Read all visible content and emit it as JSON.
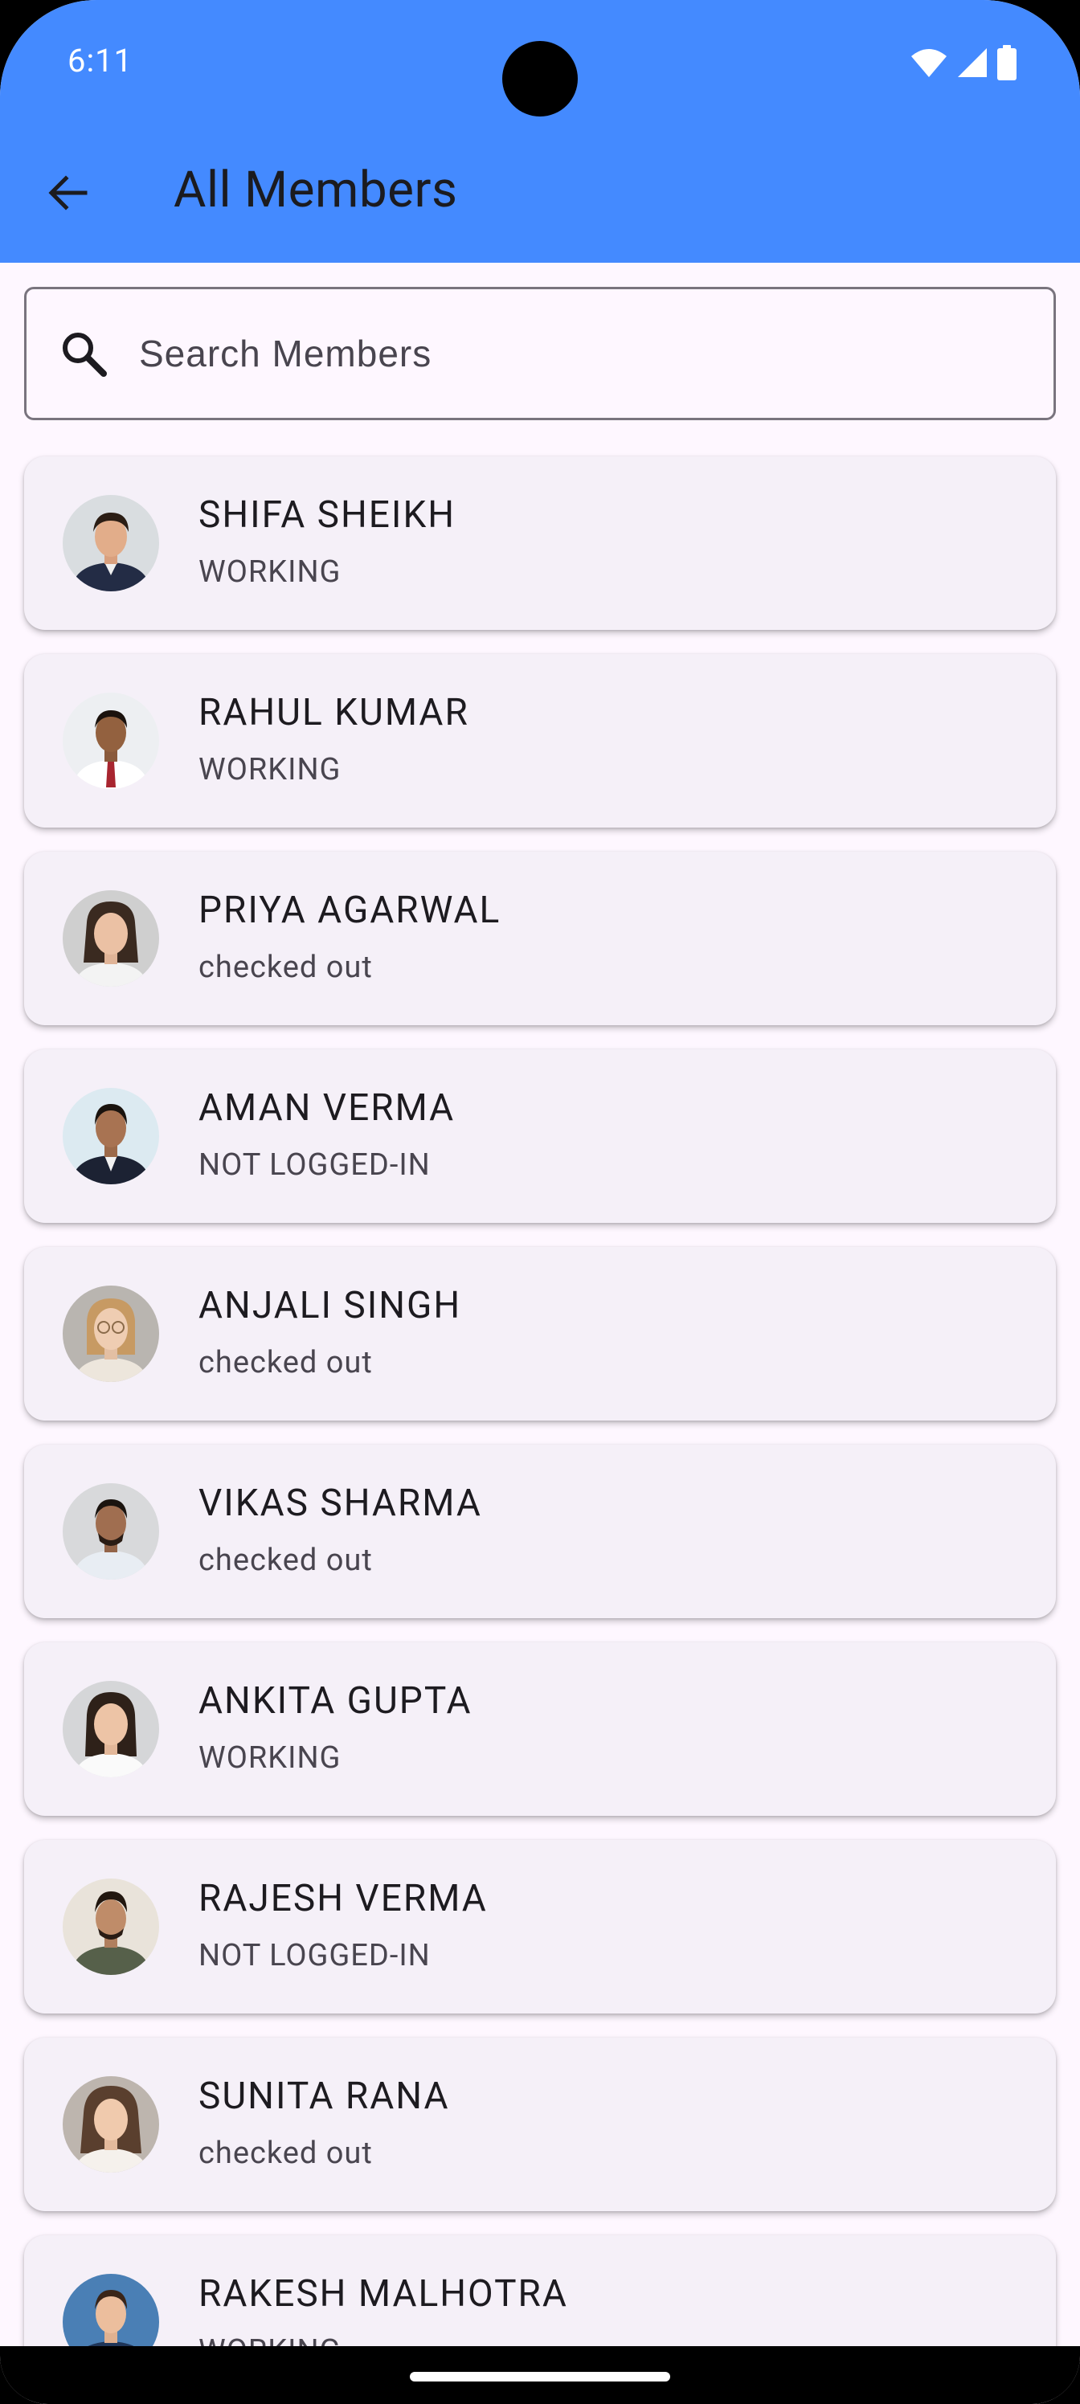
{
  "status_bar": {
    "time": "6:11",
    "icons": [
      "wifi-icon",
      "cellular-signal-icon",
      "battery-icon"
    ]
  },
  "app_bar": {
    "back_icon": "arrow-back-icon",
    "title": "All Members",
    "color": "#448AFF"
  },
  "search": {
    "icon": "search-icon",
    "placeholder": "Search Members",
    "value": ""
  },
  "members": [
    {
      "name": "SHIFA SHEIKH",
      "status": "WORKING",
      "avatar": "avatar-photo-man-suit"
    },
    {
      "name": "RAHUL KUMAR",
      "status": "WORKING",
      "avatar": "avatar-photo-man-red-tie"
    },
    {
      "name": "PRIYA AGARWAL",
      "status": "checked out",
      "avatar": "avatar-photo-woman"
    },
    {
      "name": "AMAN VERMA",
      "status": "NOT LOGGED-IN",
      "avatar": "avatar-photo-man-blazer"
    },
    {
      "name": "ANJALI SINGH",
      "status": "checked out",
      "avatar": "avatar-photo-woman-glasses"
    },
    {
      "name": "VIKAS SHARMA",
      "status": "checked out",
      "avatar": "avatar-photo-man-beard"
    },
    {
      "name": "ANKITA GUPTA",
      "status": "WORKING",
      "avatar": "avatar-photo-woman-smile"
    },
    {
      "name": "RAJESH VERMA",
      "status": "NOT LOGGED-IN",
      "avatar": "avatar-photo-man-jacket"
    },
    {
      "name": "SUNITA RANA",
      "status": "checked out",
      "avatar": "avatar-photo-woman-curly"
    },
    {
      "name": "RAKESH MALHOTRA",
      "status": "WORKING",
      "avatar": "avatar-photo-man-smile"
    }
  ],
  "colors": {
    "background": "#FEF7FF",
    "card": "#F5F0F8",
    "title_text": "#1D1B20",
    "subtitle_text": "#49454F"
  }
}
